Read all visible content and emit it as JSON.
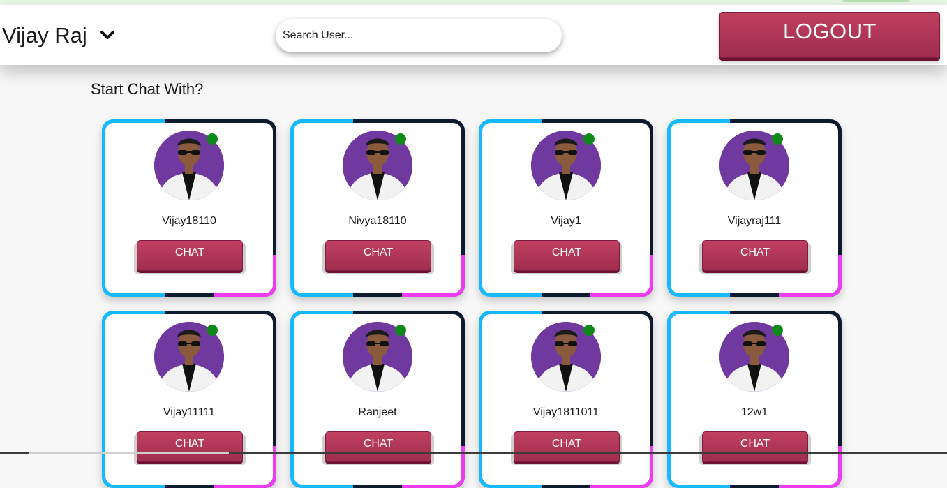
{
  "header": {
    "user_name": "Vijay Raj",
    "search_placeholder": "Search User...",
    "logout_label": "LOGOUT"
  },
  "main": {
    "title": "Start Chat With?",
    "chat_label": "CHAT",
    "users": [
      {
        "name": "Vijay18110",
        "online": true
      },
      {
        "name": "Nivya18110",
        "online": true
      },
      {
        "name": "Vijay1",
        "online": true
      },
      {
        "name": "Vijayraj111",
        "online": true
      },
      {
        "name": "Vijay11111",
        "online": true
      },
      {
        "name": "Ranjeet",
        "online": true
      },
      {
        "name": "Vijay1811011",
        "online": true
      },
      {
        "name": "12w1",
        "online": true
      }
    ]
  },
  "colors": {
    "accent": "#a8345a",
    "online": "#0f8a1a",
    "avatar_bg": "#6f39a0",
    "card_cyan": "#16b8ff",
    "card_pink": "#ee3cf2",
    "card_border": "#0e1a2e"
  },
  "icons": {
    "user_menu": "chevron-down-icon",
    "online_status": "online-dot-icon"
  }
}
